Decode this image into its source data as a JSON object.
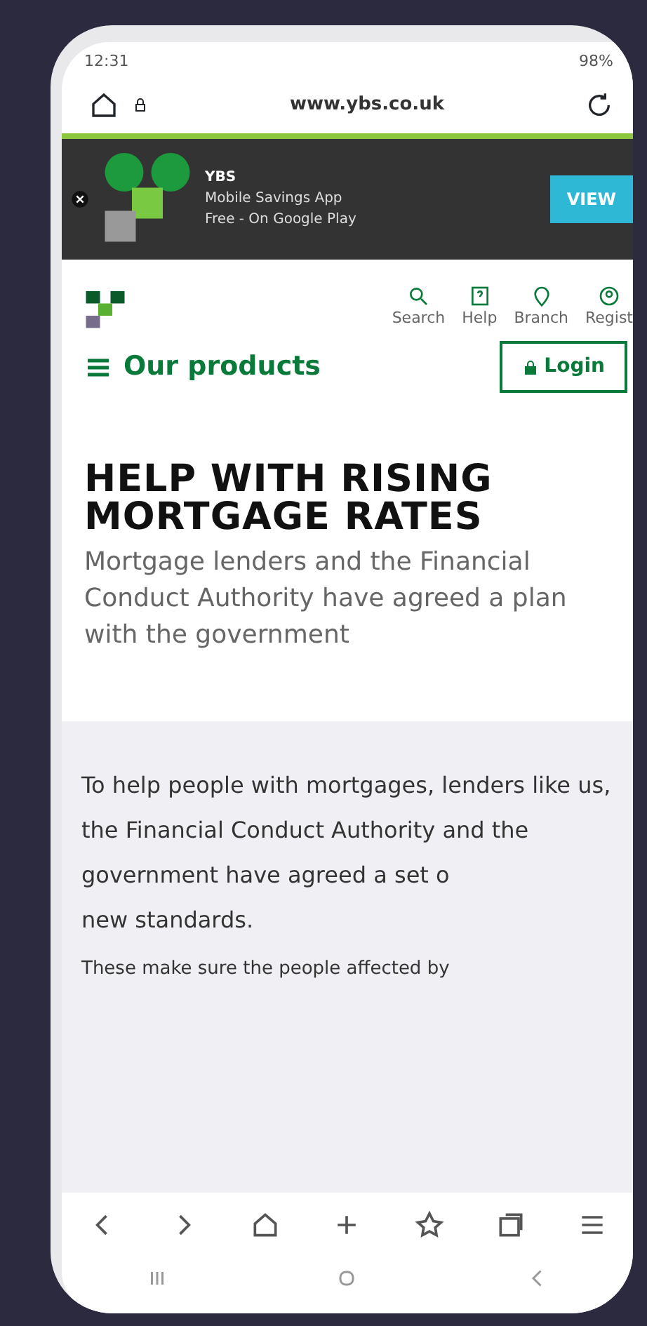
{
  "status_bar": {
    "time": "12:31",
    "battery": "98%"
  },
  "address_bar": {
    "url": "www.ybs.co.uk"
  },
  "app_banner": {
    "title": "YBS",
    "subtitle": "Mobile Savings App",
    "store": "Free - On Google Play",
    "button": "VIEW"
  },
  "header": {
    "links": [
      {
        "label": "Search",
        "kind": "search"
      },
      {
        "label": "Help",
        "kind": "help"
      },
      {
        "label": "Branch",
        "kind": "branch"
      },
      {
        "label": "Regist",
        "kind": "register"
      }
    ],
    "menu": "Our products",
    "login": "Login"
  },
  "hero": {
    "heading": "HELP WITH RISING MORTGAGE RATES",
    "text": "Mortgage lenders and the Financial Conduct Authority have agreed a plan with the government"
  },
  "article": {
    "paragraphs": [
      "To help people with mortgages, lenders like us, the Financial Conduct Authority and the government have agreed a set o",
      "new standards."
    ],
    "note": "These make sure the people affected by"
  }
}
